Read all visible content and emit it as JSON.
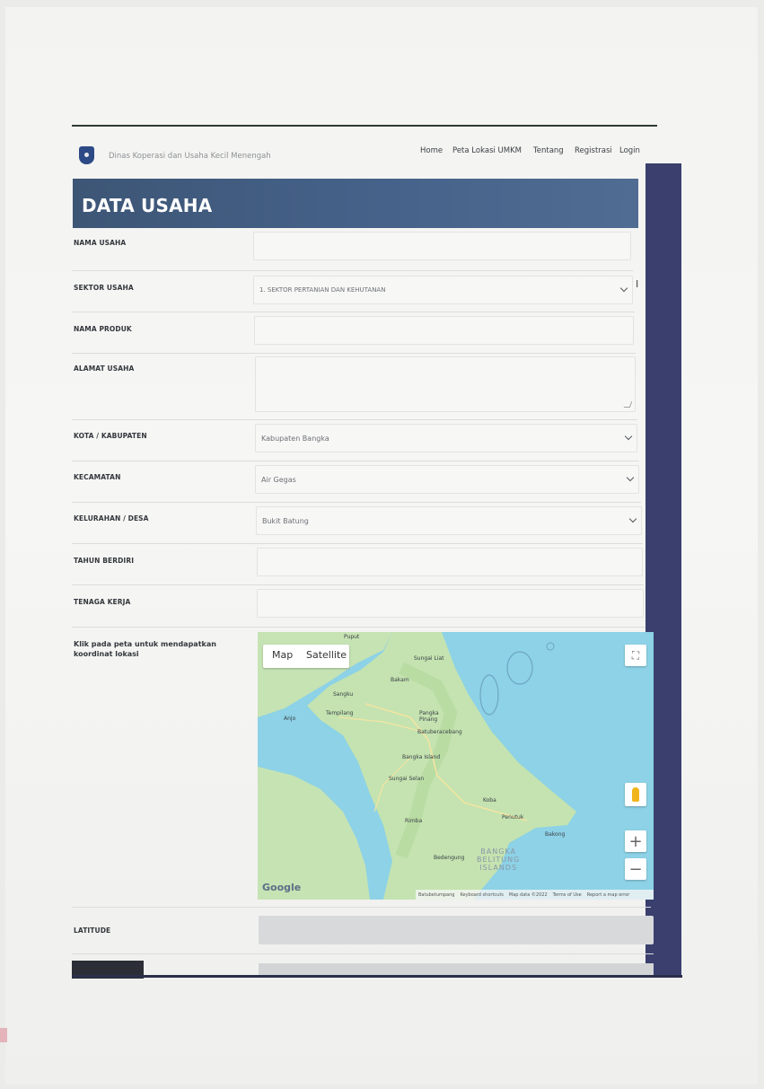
{
  "header": {
    "org_name": "Dinas Koperasi dan Usaha Kecil Menengah",
    "nav": [
      "Home",
      "Peta Lokasi UMKM",
      "Tentang",
      "Registrasi",
      "Login"
    ]
  },
  "page_title": "DATA USAHA",
  "form": {
    "nama_usaha": {
      "label": "NAMA USAHA",
      "value": ""
    },
    "sektor_usaha": {
      "label": "SEKTOR USAHA",
      "value": "1. SEKTOR PERTANIAN DAN KEHUTANAN"
    },
    "nama_produk": {
      "label": "NAMA PRODUK",
      "value": ""
    },
    "alamat_usaha": {
      "label": "ALAMAT USAHA",
      "value": ""
    },
    "kota": {
      "label": "KOTA / KABUPATEN",
      "value": "Kabupaten Bangka"
    },
    "kecamatan": {
      "label": "KECAMATAN",
      "value": "Air Gegas"
    },
    "kelurahan": {
      "label": "KELURAHAN / DESA",
      "value": "Bukit Batung"
    },
    "tahun_berdiri": {
      "label": "TAHUN BERDIRI",
      "value": ""
    },
    "tenaga_kerja": {
      "label": "TENAGA KERJA",
      "value": ""
    },
    "map_instruction": "Klik pada peta untuk mendapatkan koordinat lokasi",
    "latitude": {
      "label": "LATITUDE",
      "value": ""
    }
  },
  "map": {
    "type_map": "Map",
    "type_satellite": "Satellite",
    "zoom_in": "+",
    "zoom_out": "−",
    "google": "Google",
    "places": {
      "puput": "Puput",
      "sungailiat": "Sungai Liat",
      "bakam": "Bakam",
      "sangku": "Sangku",
      "anjo": "Anjo",
      "tempilang": "Tempilang",
      "pangkalpinang": "Pangka\nPinang",
      "batuberacebang": "Batuberacebang",
      "bangkaisland": "Bangka Island",
      "sungaiselan": "Sungai Selan",
      "koba": "Koba",
      "rimba": "Rimba",
      "penutuk": "Penutuk",
      "bakong": "Bakong",
      "bedengung": "Bedengung",
      "belitung_islands": "BANGKA\nBELITUNG\nISLANDS"
    },
    "footer": [
      "Batubetumpang",
      "Keyboard shortcuts",
      "Map data ©2022",
      "Terms of Use",
      "Report a map error"
    ]
  },
  "colors": {
    "banner": "#46628a",
    "right_bar": "#3a3f6e",
    "water": "#8dd2e6",
    "land": "#c4e3b0"
  }
}
